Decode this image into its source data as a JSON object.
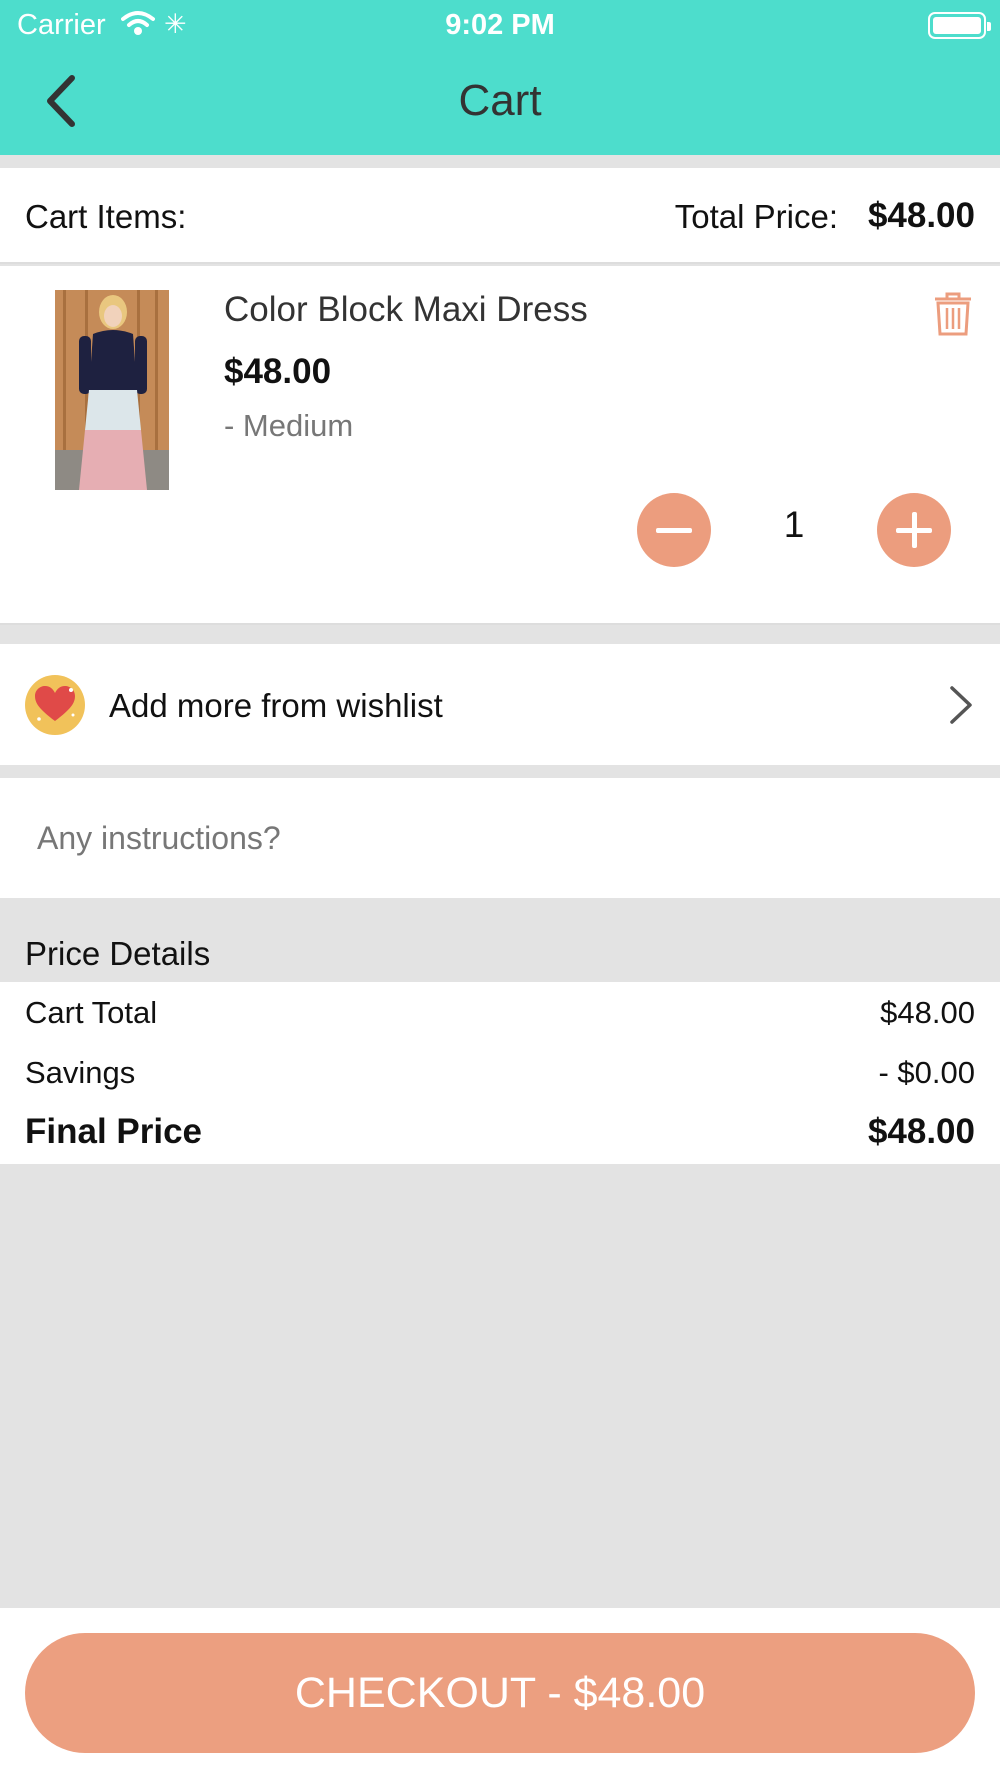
{
  "status_bar": {
    "carrier": "Carrier",
    "time": "9:02 PM"
  },
  "header": {
    "title": "Cart",
    "back_icon": "chevron-left-icon"
  },
  "summary": {
    "items_label": "Cart Items:",
    "total_label": "Total Price:",
    "total_value": "$48.00"
  },
  "cart_items": [
    {
      "name": "Color Block Maxi Dress",
      "price": "$48.00",
      "size": "- Medium",
      "quantity": "1",
      "delete_icon": "trash-icon"
    }
  ],
  "wishlist": {
    "label": "Add more from wishlist",
    "icon": "heart-icon"
  },
  "instructions": {
    "placeholder": "Any instructions?"
  },
  "price_details": {
    "heading": "Price Details",
    "cart_total_label": "Cart Total",
    "cart_total_value": "$48.00",
    "savings_label": "Savings",
    "savings_value": "- $0.00",
    "final_label": "Final Price",
    "final_value": "$48.00"
  },
  "checkout": {
    "label": "CHECKOUT - $48.00"
  },
  "colors": {
    "header": "#4dddcc",
    "accent": "#ec9d7e",
    "background": "#e3e3e3"
  }
}
